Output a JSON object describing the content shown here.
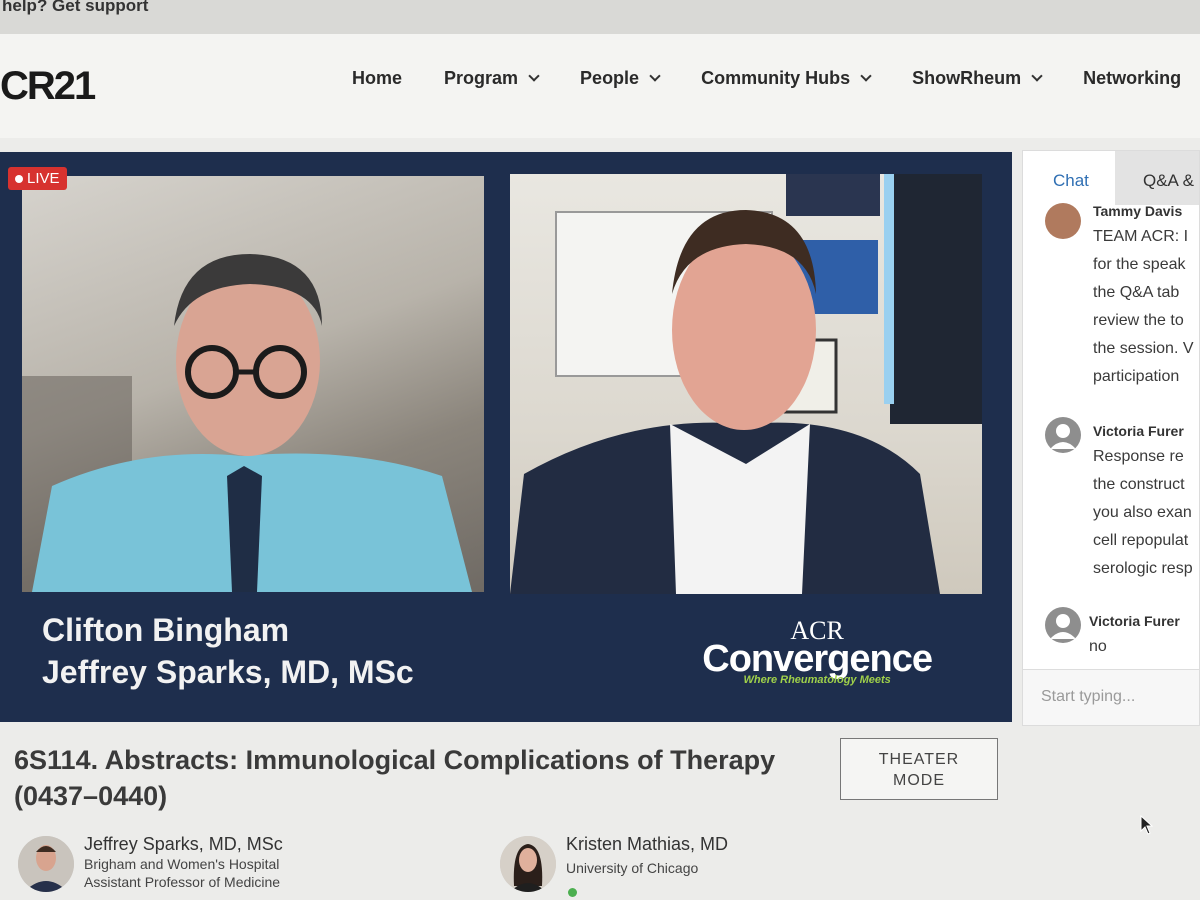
{
  "support": {
    "text": "help? Get support"
  },
  "header": {
    "logo": "CR21",
    "nav": [
      {
        "label": "Home",
        "dropdown": false
      },
      {
        "label": "Program",
        "dropdown": true
      },
      {
        "label": "People",
        "dropdown": true
      },
      {
        "label": "Community Hubs",
        "dropdown": true
      },
      {
        "label": "ShowRheum",
        "dropdown": true
      },
      {
        "label": "Networking",
        "dropdown": false
      }
    ]
  },
  "video": {
    "live_label": "LIVE",
    "lower_third": {
      "name1": "Clifton Bingham",
      "name2": "Jeffrey Sparks, MD, MSc"
    },
    "brand": {
      "acr": "ACR",
      "convergence": "Convergence",
      "tagline": "Where Rheumatology Meets"
    }
  },
  "chat": {
    "tabs": [
      "Chat",
      "Q&A &"
    ],
    "messages": [
      {
        "name": "Tammy Davis",
        "lines": [
          "TEAM ACR: I",
          "for the speak",
          "the Q&A tab",
          "review the to",
          "the session. V",
          "participation"
        ]
      },
      {
        "name": "Victoria Furer",
        "lines": [
          "Response re",
          "the construct",
          "you also exan",
          "cell repopulat",
          "serologic resp"
        ]
      },
      {
        "name": "Victoria Furer",
        "lines": [
          "no"
        ]
      }
    ],
    "input_placeholder": "Start typing..."
  },
  "session": {
    "title": "6S114. Abstracts: Immunological Complications of Therapy (0437–0440)",
    "theater_mode": {
      "line1": "THEATER",
      "line2": "MODE"
    }
  },
  "speakers": [
    {
      "name": "Jeffrey Sparks, MD, MSc",
      "affiliation": "Brigham and Women's Hospital",
      "role": "Assistant Professor of Medicine"
    },
    {
      "name": "Kristen Mathias, MD",
      "affiliation": "University of Chicago"
    }
  ],
  "colors": {
    "panel_navy": "#1e2e4d",
    "live_red": "#d7322f",
    "chat_tab_blue": "#2f6fb3",
    "brand_green": "#9fd04a"
  }
}
